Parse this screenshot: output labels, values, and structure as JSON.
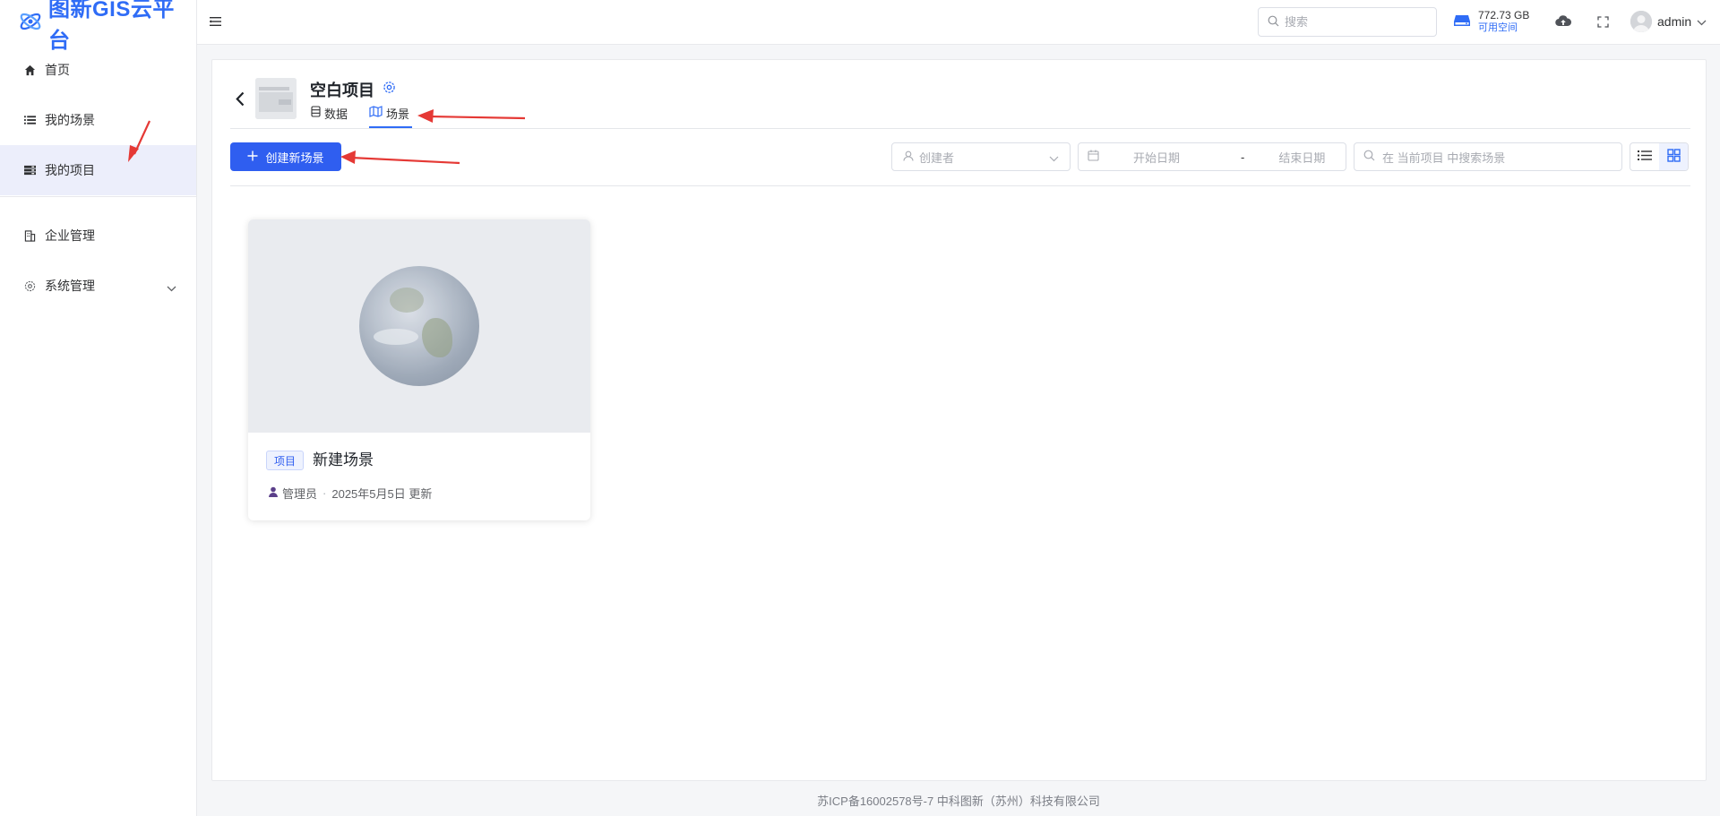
{
  "app": {
    "title": "图新GIS云平台"
  },
  "sidebar": {
    "items": [
      {
        "label": "首页",
        "icon": "home-icon"
      },
      {
        "label": "我的场景",
        "icon": "list-icon"
      },
      {
        "label": "我的项目",
        "icon": "project-icon",
        "active": true
      },
      {
        "label": "企业管理",
        "icon": "building-icon"
      },
      {
        "label": "系统管理",
        "icon": "settings-icon",
        "expandable": true
      }
    ]
  },
  "header": {
    "search_placeholder": "搜索",
    "storage_size": "772.73 GB",
    "storage_label": "可用空间",
    "username": "admin"
  },
  "project": {
    "title": "空白项目",
    "tabs": [
      {
        "label": "数据",
        "icon": "database-icon"
      },
      {
        "label": "场景",
        "icon": "map-icon",
        "active": true
      }
    ]
  },
  "toolbar": {
    "create_label": "创建新场景",
    "creator_placeholder": "创建者",
    "start_date_placeholder": "开始日期",
    "date_separator": "-",
    "end_date_placeholder": "结束日期",
    "search_placeholder": "在 当前项目 中搜索场景",
    "view_mode": "grid"
  },
  "cards": [
    {
      "tag": "项目",
      "title": "新建场景",
      "author": "管理员",
      "meta_separator": "·",
      "updated": "2025年5月5日 更新"
    }
  ],
  "footer": {
    "text": "苏ICP备16002578号-7 中科图新（苏州）科技有限公司"
  },
  "colors": {
    "accent": "#2f5ef0",
    "brand": "#2f6cf6",
    "annotation_arrow": "#e53935"
  }
}
